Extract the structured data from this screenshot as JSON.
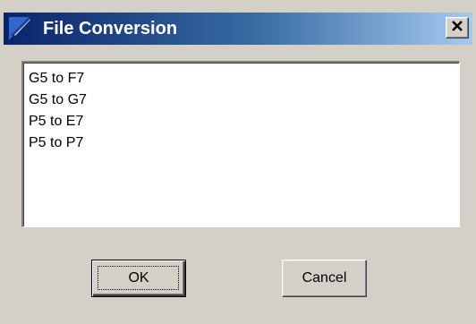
{
  "window": {
    "title": "File Conversion",
    "close_glyph": "×"
  },
  "list": {
    "items": [
      "G5 to F7",
      "G5 to G7",
      "P5 to E7",
      "P5 to P7"
    ]
  },
  "buttons": {
    "ok_label": "OK",
    "cancel_label": "Cancel"
  },
  "colors": {
    "titlebar_start": "#0a246a",
    "titlebar_end": "#a6caf0",
    "dialog_bg": "#d4d0c8"
  },
  "icons": {
    "title_icon": "app-icon",
    "close_icon": "close-icon"
  }
}
